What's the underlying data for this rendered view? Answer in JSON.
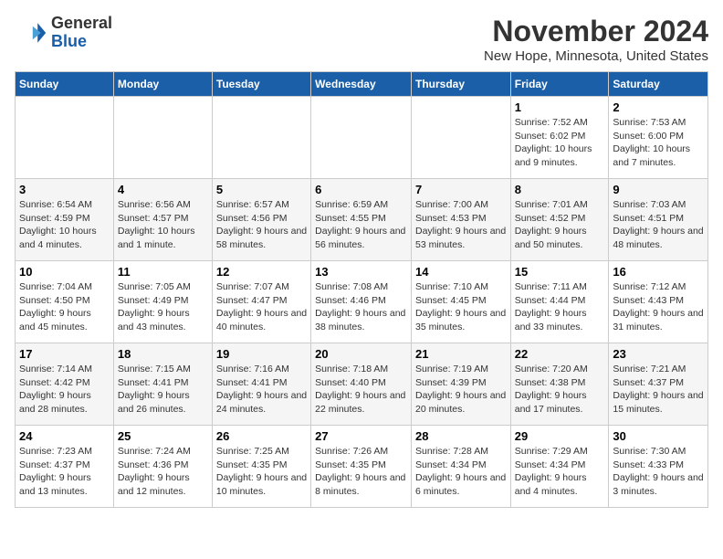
{
  "logo": {
    "line1": "General",
    "line2": "Blue"
  },
  "title": "November 2024",
  "location": "New Hope, Minnesota, United States",
  "days_of_week": [
    "Sunday",
    "Monday",
    "Tuesday",
    "Wednesday",
    "Thursday",
    "Friday",
    "Saturday"
  ],
  "weeks": [
    [
      {
        "day": "",
        "info": ""
      },
      {
        "day": "",
        "info": ""
      },
      {
        "day": "",
        "info": ""
      },
      {
        "day": "",
        "info": ""
      },
      {
        "day": "",
        "info": ""
      },
      {
        "day": "1",
        "info": "Sunrise: 7:52 AM\nSunset: 6:02 PM\nDaylight: 10 hours and 9 minutes."
      },
      {
        "day": "2",
        "info": "Sunrise: 7:53 AM\nSunset: 6:00 PM\nDaylight: 10 hours and 7 minutes."
      }
    ],
    [
      {
        "day": "3",
        "info": "Sunrise: 6:54 AM\nSunset: 4:59 PM\nDaylight: 10 hours and 4 minutes."
      },
      {
        "day": "4",
        "info": "Sunrise: 6:56 AM\nSunset: 4:57 PM\nDaylight: 10 hours and 1 minute."
      },
      {
        "day": "5",
        "info": "Sunrise: 6:57 AM\nSunset: 4:56 PM\nDaylight: 9 hours and 58 minutes."
      },
      {
        "day": "6",
        "info": "Sunrise: 6:59 AM\nSunset: 4:55 PM\nDaylight: 9 hours and 56 minutes."
      },
      {
        "day": "7",
        "info": "Sunrise: 7:00 AM\nSunset: 4:53 PM\nDaylight: 9 hours and 53 minutes."
      },
      {
        "day": "8",
        "info": "Sunrise: 7:01 AM\nSunset: 4:52 PM\nDaylight: 9 hours and 50 minutes."
      },
      {
        "day": "9",
        "info": "Sunrise: 7:03 AM\nSunset: 4:51 PM\nDaylight: 9 hours and 48 minutes."
      }
    ],
    [
      {
        "day": "10",
        "info": "Sunrise: 7:04 AM\nSunset: 4:50 PM\nDaylight: 9 hours and 45 minutes."
      },
      {
        "day": "11",
        "info": "Sunrise: 7:05 AM\nSunset: 4:49 PM\nDaylight: 9 hours and 43 minutes."
      },
      {
        "day": "12",
        "info": "Sunrise: 7:07 AM\nSunset: 4:47 PM\nDaylight: 9 hours and 40 minutes."
      },
      {
        "day": "13",
        "info": "Sunrise: 7:08 AM\nSunset: 4:46 PM\nDaylight: 9 hours and 38 minutes."
      },
      {
        "day": "14",
        "info": "Sunrise: 7:10 AM\nSunset: 4:45 PM\nDaylight: 9 hours and 35 minutes."
      },
      {
        "day": "15",
        "info": "Sunrise: 7:11 AM\nSunset: 4:44 PM\nDaylight: 9 hours and 33 minutes."
      },
      {
        "day": "16",
        "info": "Sunrise: 7:12 AM\nSunset: 4:43 PM\nDaylight: 9 hours and 31 minutes."
      }
    ],
    [
      {
        "day": "17",
        "info": "Sunrise: 7:14 AM\nSunset: 4:42 PM\nDaylight: 9 hours and 28 minutes."
      },
      {
        "day": "18",
        "info": "Sunrise: 7:15 AM\nSunset: 4:41 PM\nDaylight: 9 hours and 26 minutes."
      },
      {
        "day": "19",
        "info": "Sunrise: 7:16 AM\nSunset: 4:41 PM\nDaylight: 9 hours and 24 minutes."
      },
      {
        "day": "20",
        "info": "Sunrise: 7:18 AM\nSunset: 4:40 PM\nDaylight: 9 hours and 22 minutes."
      },
      {
        "day": "21",
        "info": "Sunrise: 7:19 AM\nSunset: 4:39 PM\nDaylight: 9 hours and 20 minutes."
      },
      {
        "day": "22",
        "info": "Sunrise: 7:20 AM\nSunset: 4:38 PM\nDaylight: 9 hours and 17 minutes."
      },
      {
        "day": "23",
        "info": "Sunrise: 7:21 AM\nSunset: 4:37 PM\nDaylight: 9 hours and 15 minutes."
      }
    ],
    [
      {
        "day": "24",
        "info": "Sunrise: 7:23 AM\nSunset: 4:37 PM\nDaylight: 9 hours and 13 minutes."
      },
      {
        "day": "25",
        "info": "Sunrise: 7:24 AM\nSunset: 4:36 PM\nDaylight: 9 hours and 12 minutes."
      },
      {
        "day": "26",
        "info": "Sunrise: 7:25 AM\nSunset: 4:35 PM\nDaylight: 9 hours and 10 minutes."
      },
      {
        "day": "27",
        "info": "Sunrise: 7:26 AM\nSunset: 4:35 PM\nDaylight: 9 hours and 8 minutes."
      },
      {
        "day": "28",
        "info": "Sunrise: 7:28 AM\nSunset: 4:34 PM\nDaylight: 9 hours and 6 minutes."
      },
      {
        "day": "29",
        "info": "Sunrise: 7:29 AM\nSunset: 4:34 PM\nDaylight: 9 hours and 4 minutes."
      },
      {
        "day": "30",
        "info": "Sunrise: 7:30 AM\nSunset: 4:33 PM\nDaylight: 9 hours and 3 minutes."
      }
    ]
  ]
}
